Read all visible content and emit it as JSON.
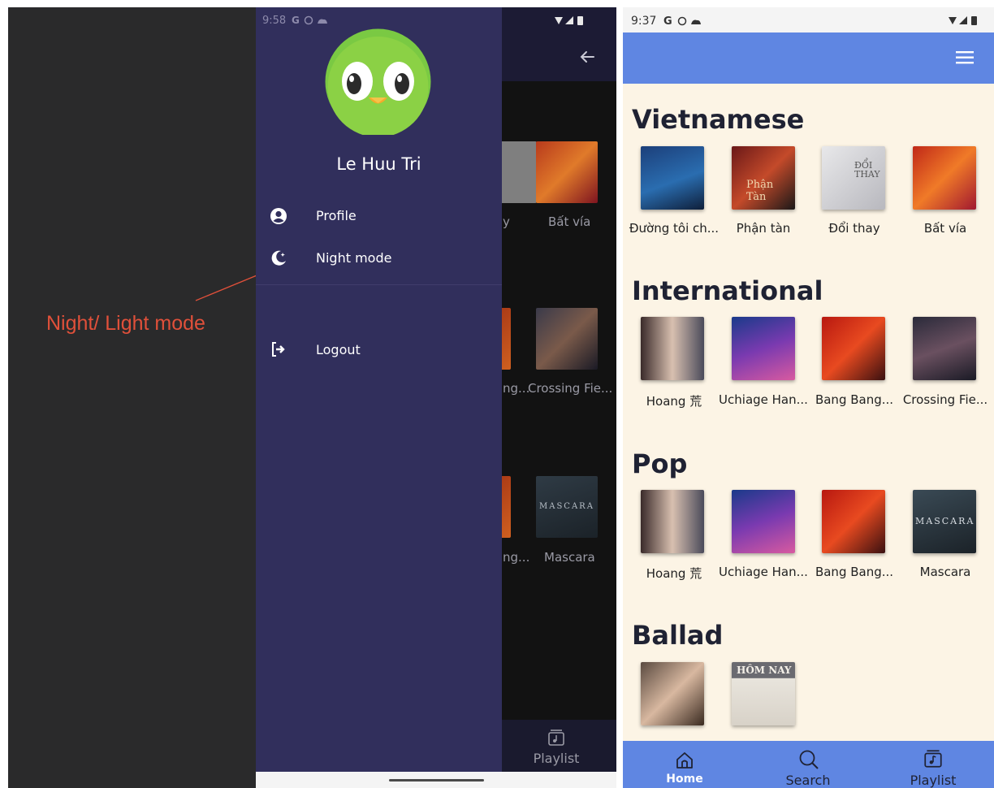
{
  "annotation": {
    "text": "Night/ Light mode"
  },
  "dark_screen": {
    "status_time": "9:58",
    "back_icon": "arrow-left-icon",
    "visible_songs": [
      {
        "label": "y"
      },
      {
        "label": "Bất vía"
      },
      {
        "label": "ng..."
      },
      {
        "label": "Crossing Fie..."
      },
      {
        "label": "ng..."
      },
      {
        "label": "Mascara"
      }
    ],
    "bottom_nav": {
      "playlist_label": "Playlist"
    }
  },
  "drawer": {
    "user_name": "Le Huu Tri",
    "items": [
      {
        "label": "Profile",
        "icon": "user-circle-icon"
      },
      {
        "label": "Night mode",
        "icon": "moon-icon"
      },
      {
        "label": "Logout",
        "icon": "logout-icon"
      }
    ]
  },
  "light_screen": {
    "status_time": "9:37",
    "menu_icon": "hamburger-icon",
    "sections": [
      {
        "title": "Vietnamese",
        "songs": [
          "Đường tôi ch...",
          "Phận tàn",
          "Đổi thay",
          "Bất vía"
        ]
      },
      {
        "title": "International",
        "songs": [
          "Hoang 荒",
          "Uchiage Han...",
          "Bang Bang...",
          "Crossing Fie..."
        ]
      },
      {
        "title": "Pop",
        "songs": [
          "Hoang 荒",
          "Uchiage Han...",
          "Bang Bang...",
          "Mascara"
        ]
      },
      {
        "title": "Ballad",
        "songs": [
          "",
          ""
        ]
      }
    ],
    "bottom_nav": [
      {
        "label": "Home",
        "icon": "home-icon",
        "active": true
      },
      {
        "label": "Search",
        "icon": "search-icon",
        "active": false
      },
      {
        "label": "Playlist",
        "icon": "playlist-icon",
        "active": false
      }
    ]
  },
  "colors": {
    "drawer_bg": "#312f5c",
    "light_accent": "#5f86e2",
    "light_bg": "#fcf4e5",
    "annotation": "#e0503a"
  }
}
